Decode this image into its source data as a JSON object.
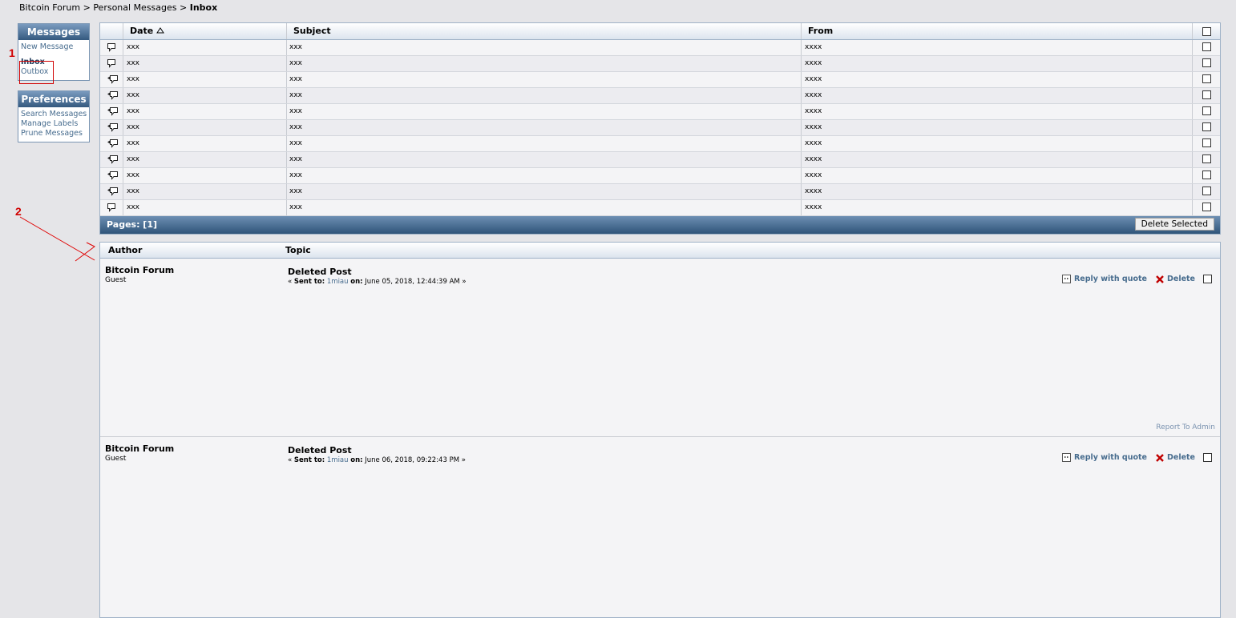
{
  "breadcrumb": {
    "forum": "Bitcoin Forum",
    "sep1": " > ",
    "pm": "Personal Messages",
    "sep2": " > ",
    "current": "Inbox"
  },
  "sidebar": {
    "messages": {
      "title": "Messages",
      "items": [
        "New Message",
        "Inbox",
        "Outbox"
      ]
    },
    "preferences": {
      "title": "Preferences",
      "items": [
        "Search Messages",
        "Manage Labels",
        "Prune Messages"
      ]
    }
  },
  "annotations": {
    "one": "1",
    "two": "2"
  },
  "inbox": {
    "headers": {
      "date": "Date",
      "subject": "Subject",
      "from": "From"
    },
    "rows": [
      {
        "date": "xxx",
        "subject": "xxx",
        "from": "xxxx",
        "icon": "message-icon"
      },
      {
        "date": "xxx",
        "subject": "xxx",
        "from": "xxxx",
        "icon": "message-icon"
      },
      {
        "date": "xxx",
        "subject": "xxx",
        "from": "xxxx",
        "icon": "replied-message-icon"
      },
      {
        "date": "xxx",
        "subject": "xxx",
        "from": "xxxx",
        "icon": "replied-message-icon"
      },
      {
        "date": "xxx",
        "subject": "xxx",
        "from": "xxxx",
        "icon": "replied-message-icon"
      },
      {
        "date": "xxx",
        "subject": "xxx",
        "from": "xxxx",
        "icon": "replied-message-icon"
      },
      {
        "date": "xxx",
        "subject": "xxx",
        "from": "xxxx",
        "icon": "replied-message-icon"
      },
      {
        "date": "xxx",
        "subject": "xxx",
        "from": "xxxx",
        "icon": "replied-message-icon"
      },
      {
        "date": "xxx",
        "subject": "xxx",
        "from": "xxxx",
        "icon": "replied-message-icon"
      },
      {
        "date": "xxx",
        "subject": "xxx",
        "from": "xxxx",
        "icon": "replied-message-icon"
      },
      {
        "date": "xxx",
        "subject": "xxx",
        "from": "xxxx",
        "icon": "message-icon"
      }
    ],
    "pages": "Pages: [1]",
    "delete_selected": "Delete Selected"
  },
  "posts_header": {
    "author": "Author",
    "topic": "Topic"
  },
  "posts": [
    {
      "author": "Bitcoin Forum",
      "role": "Guest",
      "title": "Deleted Post",
      "meta_prefix": "« ",
      "sent_to_label": "Sent to:",
      "recipient": "1miau",
      "on_label": "on:",
      "date": "June 05, 2018, 12:44:39 AM",
      "meta_suffix": " »",
      "reply": "Reply with quote",
      "delete": "Delete",
      "report": "Report To Admin"
    },
    {
      "author": "Bitcoin Forum",
      "role": "Guest",
      "title": "Deleted Post",
      "meta_prefix": "« ",
      "sent_to_label": "Sent to:",
      "recipient": "1miau",
      "on_label": "on:",
      "date": "June 06, 2018, 09:22:43 PM",
      "meta_suffix": " »",
      "reply": "Reply with quote",
      "delete": "Delete"
    }
  ]
}
